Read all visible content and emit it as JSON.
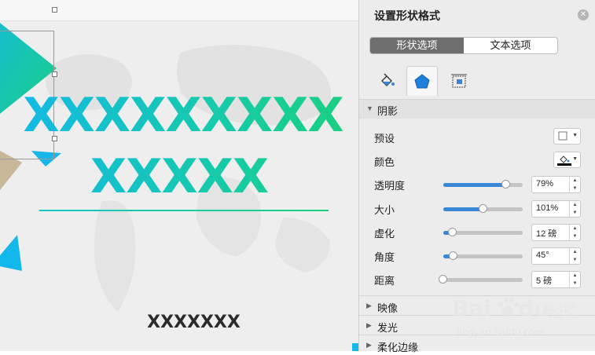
{
  "slide": {
    "headline_1": "XXXXXXXXX",
    "headline_2": "XXXXX",
    "subtitle": "XXXXXXX"
  },
  "pane": {
    "title": "设置形状格式",
    "close": "✕",
    "segments": [
      "形状选项",
      "文本选项"
    ],
    "active_segment": "形状选项",
    "icon_tabs": [
      "paint-bucket-icon",
      "pentagon-icon",
      "size-layout-icon"
    ],
    "shadow_section": {
      "label": "阴影",
      "expanded": true,
      "preset_label": "预设",
      "color_label": "颜色",
      "color_value": "#000000",
      "sliders": [
        {
          "label": "透明度",
          "value_text": "79%",
          "fraction": 0.79
        },
        {
          "label": "大小",
          "value_text": "101%",
          "fraction": 0.5
        },
        {
          "label": "虚化",
          "value_text": "12 磅",
          "fraction": 0.12
        },
        {
          "label": "角度",
          "value_text": "45°",
          "fraction": 0.125
        },
        {
          "label": "距离",
          "value_text": "5 磅",
          "fraction": 0.0
        }
      ]
    },
    "collapsed_sections": [
      "映像",
      "发光",
      "柔化边缘"
    ]
  },
  "watermark": {
    "brand": "Bai",
    "brand_suffix": "du",
    "product": "经验",
    "url": "jingyan.baidu.com"
  },
  "colors": {
    "accent_blue": "#3a86d6",
    "gradient_start": "#13b8ea",
    "gradient_end": "#1ad07d"
  }
}
